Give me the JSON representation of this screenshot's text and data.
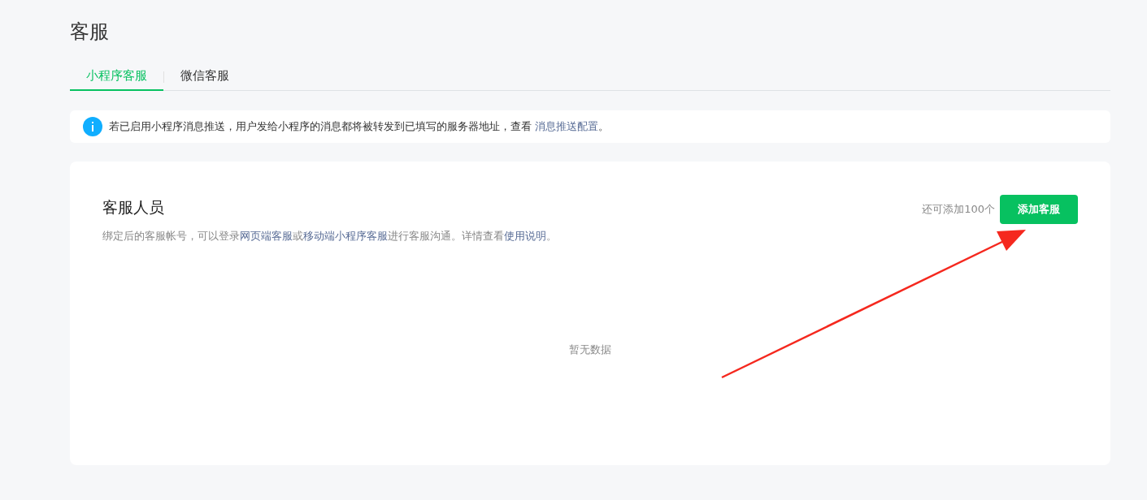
{
  "page": {
    "title": "客服"
  },
  "tabs": [
    {
      "label": "小程序客服",
      "selected": true
    },
    {
      "label": "微信客服",
      "selected": false
    }
  ],
  "notice": {
    "parts": [
      {
        "kind": "text",
        "text": "若已启用小程序消息推送，用户发给小程序的消息都将被转发到已填写的服务器地址，查看 "
      },
      {
        "kind": "link",
        "text": "消息推送配置"
      },
      {
        "kind": "text",
        "text": "。"
      }
    ]
  },
  "staff_panel": {
    "title": "客服人员",
    "description": [
      {
        "kind": "text",
        "text": "绑定后的客服帐号，可以登录"
      },
      {
        "kind": "link",
        "text": "网页端客服"
      },
      {
        "kind": "text",
        "text": "或"
      },
      {
        "kind": "link",
        "text": "移动端小程序客服"
      },
      {
        "kind": "text",
        "text": "进行客服沟通。详情查看"
      },
      {
        "kind": "link",
        "text": "使用说明"
      },
      {
        "kind": "text",
        "text": "。"
      }
    ],
    "remaining": "还可添加100个",
    "add_button": "添加客服",
    "empty_text": "暂无数据"
  }
}
